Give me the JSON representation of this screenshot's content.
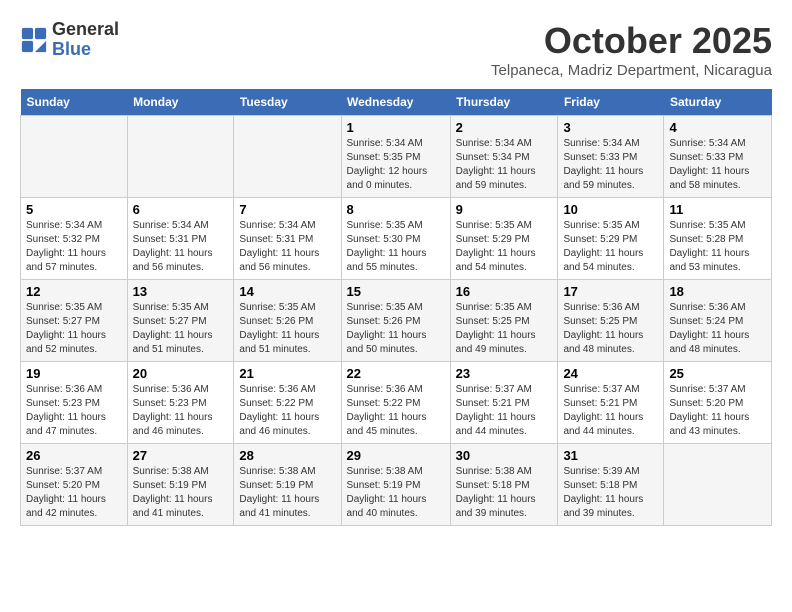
{
  "header": {
    "logo_line1": "General",
    "logo_line2": "Blue",
    "month_title": "October 2025",
    "subtitle": "Telpaneca, Madriz Department, Nicaragua"
  },
  "days_of_week": [
    "Sunday",
    "Monday",
    "Tuesday",
    "Wednesday",
    "Thursday",
    "Friday",
    "Saturday"
  ],
  "weeks": [
    [
      {
        "day": "",
        "info": ""
      },
      {
        "day": "",
        "info": ""
      },
      {
        "day": "",
        "info": ""
      },
      {
        "day": "1",
        "info": "Sunrise: 5:34 AM\nSunset: 5:35 PM\nDaylight: 12 hours\nand 0 minutes."
      },
      {
        "day": "2",
        "info": "Sunrise: 5:34 AM\nSunset: 5:34 PM\nDaylight: 11 hours\nand 59 minutes."
      },
      {
        "day": "3",
        "info": "Sunrise: 5:34 AM\nSunset: 5:33 PM\nDaylight: 11 hours\nand 59 minutes."
      },
      {
        "day": "4",
        "info": "Sunrise: 5:34 AM\nSunset: 5:33 PM\nDaylight: 11 hours\nand 58 minutes."
      }
    ],
    [
      {
        "day": "5",
        "info": "Sunrise: 5:34 AM\nSunset: 5:32 PM\nDaylight: 11 hours\nand 57 minutes."
      },
      {
        "day": "6",
        "info": "Sunrise: 5:34 AM\nSunset: 5:31 PM\nDaylight: 11 hours\nand 56 minutes."
      },
      {
        "day": "7",
        "info": "Sunrise: 5:34 AM\nSunset: 5:31 PM\nDaylight: 11 hours\nand 56 minutes."
      },
      {
        "day": "8",
        "info": "Sunrise: 5:35 AM\nSunset: 5:30 PM\nDaylight: 11 hours\nand 55 minutes."
      },
      {
        "day": "9",
        "info": "Sunrise: 5:35 AM\nSunset: 5:29 PM\nDaylight: 11 hours\nand 54 minutes."
      },
      {
        "day": "10",
        "info": "Sunrise: 5:35 AM\nSunset: 5:29 PM\nDaylight: 11 hours\nand 54 minutes."
      },
      {
        "day": "11",
        "info": "Sunrise: 5:35 AM\nSunset: 5:28 PM\nDaylight: 11 hours\nand 53 minutes."
      }
    ],
    [
      {
        "day": "12",
        "info": "Sunrise: 5:35 AM\nSunset: 5:27 PM\nDaylight: 11 hours\nand 52 minutes."
      },
      {
        "day": "13",
        "info": "Sunrise: 5:35 AM\nSunset: 5:27 PM\nDaylight: 11 hours\nand 51 minutes."
      },
      {
        "day": "14",
        "info": "Sunrise: 5:35 AM\nSunset: 5:26 PM\nDaylight: 11 hours\nand 51 minutes."
      },
      {
        "day": "15",
        "info": "Sunrise: 5:35 AM\nSunset: 5:26 PM\nDaylight: 11 hours\nand 50 minutes."
      },
      {
        "day": "16",
        "info": "Sunrise: 5:35 AM\nSunset: 5:25 PM\nDaylight: 11 hours\nand 49 minutes."
      },
      {
        "day": "17",
        "info": "Sunrise: 5:36 AM\nSunset: 5:25 PM\nDaylight: 11 hours\nand 48 minutes."
      },
      {
        "day": "18",
        "info": "Sunrise: 5:36 AM\nSunset: 5:24 PM\nDaylight: 11 hours\nand 48 minutes."
      }
    ],
    [
      {
        "day": "19",
        "info": "Sunrise: 5:36 AM\nSunset: 5:23 PM\nDaylight: 11 hours\nand 47 minutes."
      },
      {
        "day": "20",
        "info": "Sunrise: 5:36 AM\nSunset: 5:23 PM\nDaylight: 11 hours\nand 46 minutes."
      },
      {
        "day": "21",
        "info": "Sunrise: 5:36 AM\nSunset: 5:22 PM\nDaylight: 11 hours\nand 46 minutes."
      },
      {
        "day": "22",
        "info": "Sunrise: 5:36 AM\nSunset: 5:22 PM\nDaylight: 11 hours\nand 45 minutes."
      },
      {
        "day": "23",
        "info": "Sunrise: 5:37 AM\nSunset: 5:21 PM\nDaylight: 11 hours\nand 44 minutes."
      },
      {
        "day": "24",
        "info": "Sunrise: 5:37 AM\nSunset: 5:21 PM\nDaylight: 11 hours\nand 44 minutes."
      },
      {
        "day": "25",
        "info": "Sunrise: 5:37 AM\nSunset: 5:20 PM\nDaylight: 11 hours\nand 43 minutes."
      }
    ],
    [
      {
        "day": "26",
        "info": "Sunrise: 5:37 AM\nSunset: 5:20 PM\nDaylight: 11 hours\nand 42 minutes."
      },
      {
        "day": "27",
        "info": "Sunrise: 5:38 AM\nSunset: 5:19 PM\nDaylight: 11 hours\nand 41 minutes."
      },
      {
        "day": "28",
        "info": "Sunrise: 5:38 AM\nSunset: 5:19 PM\nDaylight: 11 hours\nand 41 minutes."
      },
      {
        "day": "29",
        "info": "Sunrise: 5:38 AM\nSunset: 5:19 PM\nDaylight: 11 hours\nand 40 minutes."
      },
      {
        "day": "30",
        "info": "Sunrise: 5:38 AM\nSunset: 5:18 PM\nDaylight: 11 hours\nand 39 minutes."
      },
      {
        "day": "31",
        "info": "Sunrise: 5:39 AM\nSunset: 5:18 PM\nDaylight: 11 hours\nand 39 minutes."
      },
      {
        "day": "",
        "info": ""
      }
    ]
  ]
}
